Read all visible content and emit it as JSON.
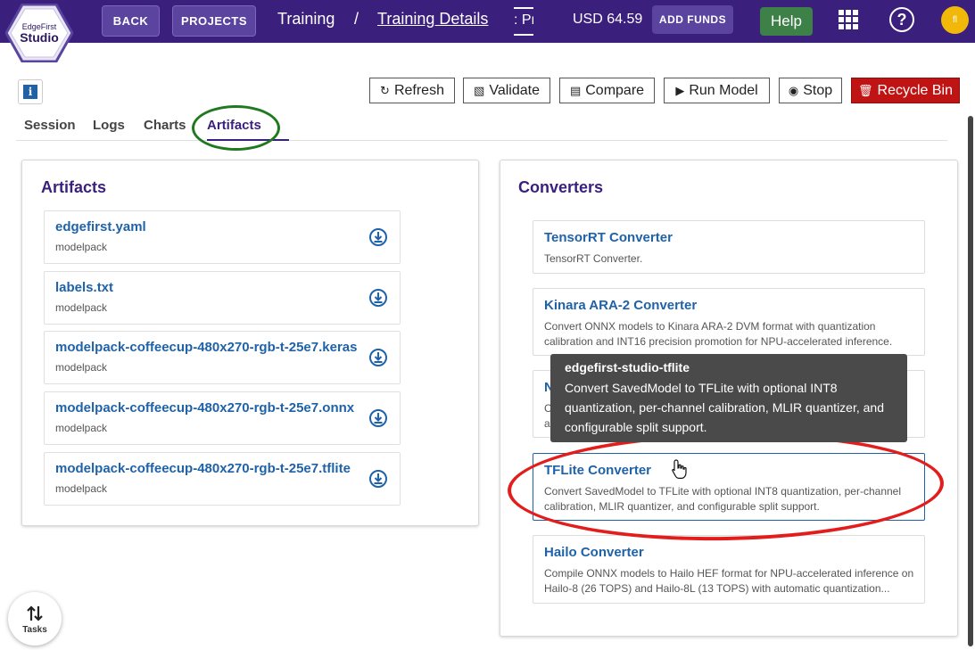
{
  "header": {
    "logo": {
      "line1": "EdgeFirst",
      "line2": "Studio"
    },
    "back_label": "BACK",
    "projects_label": "PROJECTS",
    "breadcrumb": {
      "item1": "Training",
      "separator": "/",
      "item2": "Training Details",
      "item3": ": Pr"
    },
    "balance": "USD 64.59",
    "add_funds_label": "ADD FUNDS",
    "help_label": "Help",
    "avatar_initials": "fl",
    "colors": {
      "bar": "#3a1f7d",
      "help": "#3d8048",
      "avatar": "#f1b80a"
    }
  },
  "toolbar": {
    "info_label": "i",
    "refresh": "Refresh",
    "validate": "Validate",
    "compare": "Compare",
    "run_model": "Run Model",
    "stop": "Stop",
    "recycle_bin": "Recycle Bin"
  },
  "tabs": {
    "session": "Session",
    "logs": "Logs",
    "charts": "Charts",
    "artifacts": "Artifacts",
    "active": "Artifacts"
  },
  "artifacts": {
    "title": "Artifacts",
    "items": [
      {
        "name": "edgefirst.yaml",
        "sub": "modelpack"
      },
      {
        "name": "labels.txt",
        "sub": "modelpack"
      },
      {
        "name": "modelpack-coffeecup-480x270-rgb-t-25e7.keras",
        "sub": "modelpack"
      },
      {
        "name": "modelpack-coffeecup-480x270-rgb-t-25e7.onnx",
        "sub": "modelpack"
      },
      {
        "name": "modelpack-coffeecup-480x270-rgb-t-25e7.tflite",
        "sub": "modelpack"
      }
    ]
  },
  "converters": {
    "title": "Converters",
    "items": [
      {
        "name": "TensorRT Converter",
        "desc": "TensorRT Converter."
      },
      {
        "name": "Kinara ARA-2 Converter",
        "desc": "Convert ONNX models to Kinara ARA-2 DVM format with quantization calibration and INT16 precision promotion for NPU-accelerated inference."
      },
      {
        "name": "N",
        "desc": "C\na"
      },
      {
        "name": "TFLite Converter",
        "desc": "Convert SavedModel to TFLite with optional INT8 quantization, per-channel calibration, MLIR quantizer, and configurable split support."
      },
      {
        "name": "Hailo Converter",
        "desc": "Compile ONNX models to Hailo HEF format for NPU-accelerated inference on Hailo-8 (26 TOPS) and Hailo-8L (13 TOPS) with automatic quantization..."
      }
    ]
  },
  "tooltip": {
    "title": "edgefirst-studio-tflite",
    "text": "Convert SavedModel to TFLite with optional INT8 quantization, per-channel calibration, MLIR quantizer, and configurable split support."
  },
  "tasks": {
    "label": "Tasks"
  }
}
